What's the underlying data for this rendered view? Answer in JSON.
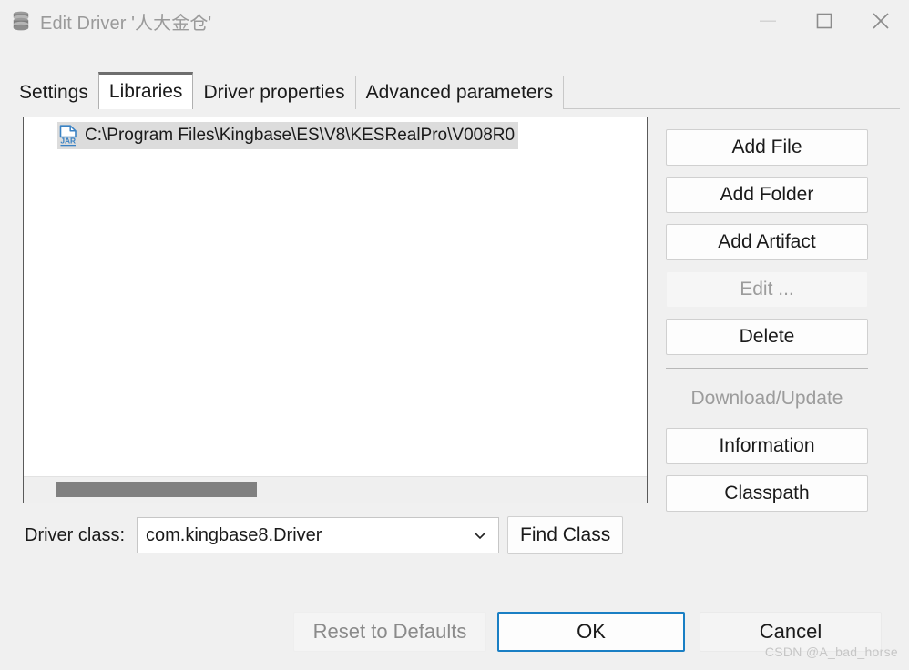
{
  "window": {
    "title": "Edit Driver '人大金仓'",
    "icon": "database-icon",
    "controls": {
      "minimize": "minimize-icon",
      "maximize": "maximize-icon",
      "close": "close-icon"
    }
  },
  "tabs": [
    {
      "label": "Settings",
      "active": false
    },
    {
      "label": "Libraries",
      "active": true
    },
    {
      "label": "Driver properties",
      "active": false
    },
    {
      "label": "Advanced parameters",
      "active": false
    }
  ],
  "libraries": {
    "items": [
      {
        "icon": "jar-file-icon",
        "path": "C:\\Program Files\\Kingbase\\ES\\V8\\KESRealPro\\V008R0",
        "selected": true
      }
    ],
    "scrollbar": {
      "orientation": "horizontal",
      "thumb_name": "hscroll-thumb"
    }
  },
  "side_buttons": [
    {
      "label": "Add File",
      "name": "add-file-button",
      "disabled": false
    },
    {
      "label": "Add Folder",
      "name": "add-folder-button",
      "disabled": false
    },
    {
      "label": "Add Artifact",
      "name": "add-artifact-button",
      "disabled": false
    },
    {
      "label": "Edit ...",
      "name": "edit-button",
      "disabled": true
    },
    {
      "label": "Delete",
      "name": "delete-button",
      "disabled": false
    },
    {
      "label": "Download/Update",
      "name": "download-update-button",
      "disabled": true
    },
    {
      "label": "Information",
      "name": "information-button",
      "disabled": false
    },
    {
      "label": "Classpath",
      "name": "classpath-button",
      "disabled": false
    }
  ],
  "driver_class": {
    "label": "Driver class:",
    "value": "com.kingbase8.Driver",
    "find_class_label": "Find Class",
    "dropdown_icon": "chevron-down-icon"
  },
  "footer": {
    "reset_label": "Reset to Defaults",
    "ok_label": "OK",
    "cancel_label": "Cancel"
  },
  "watermark": "CSDN @A_bad_horse",
  "colors": {
    "accent_focus": "#1a7fc4",
    "jar_icon": "#3a82c4",
    "selection": "#dcdcdc",
    "window_bg": "#f0f0f0",
    "scrollbar_thumb": "#808080"
  }
}
